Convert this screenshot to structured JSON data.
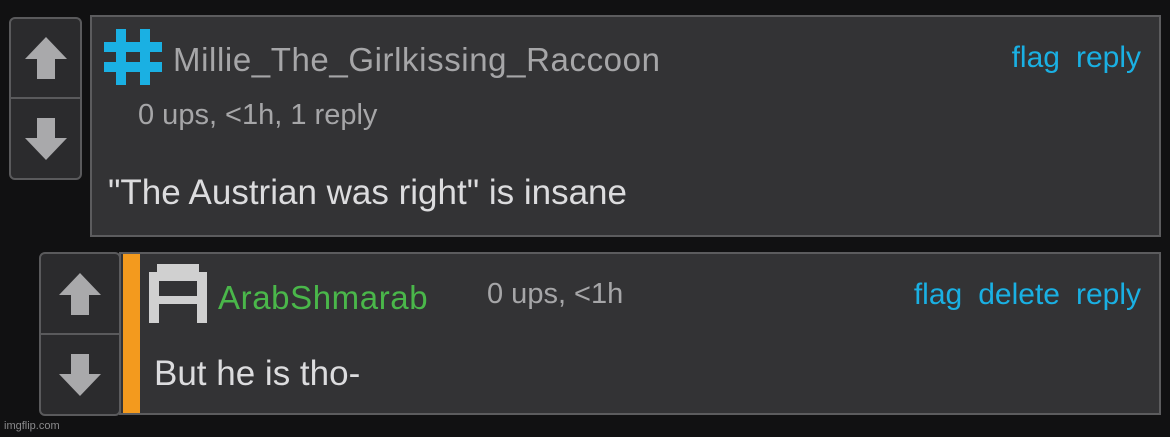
{
  "colors": {
    "background": "#111112",
    "panel": "#333335",
    "link": "#1ab0e3",
    "op_username": "#a6a6a8",
    "reply_username": "#4ab74a",
    "accent_bar": "#f39a1e",
    "icon_blue": "#1ab0e3",
    "arrow": "#a9a9ab"
  },
  "comments": [
    {
      "avatar_icon": "hashtag-icon",
      "username": "Millie_The_Girlkissing_Raccoon",
      "meta": "0 ups, <1h, 1 reply",
      "text": "\"The Austrian was right\" is insane",
      "actions": [
        "flag",
        "reply"
      ]
    },
    {
      "avatar_icon": "pixel-arch-avatar-icon",
      "username": "ArabShmarab",
      "meta": "0 ups, <1h",
      "text": "But he is tho-",
      "actions": [
        "flag",
        "delete",
        "reply"
      ]
    }
  ],
  "watermark": "imgflip.com"
}
